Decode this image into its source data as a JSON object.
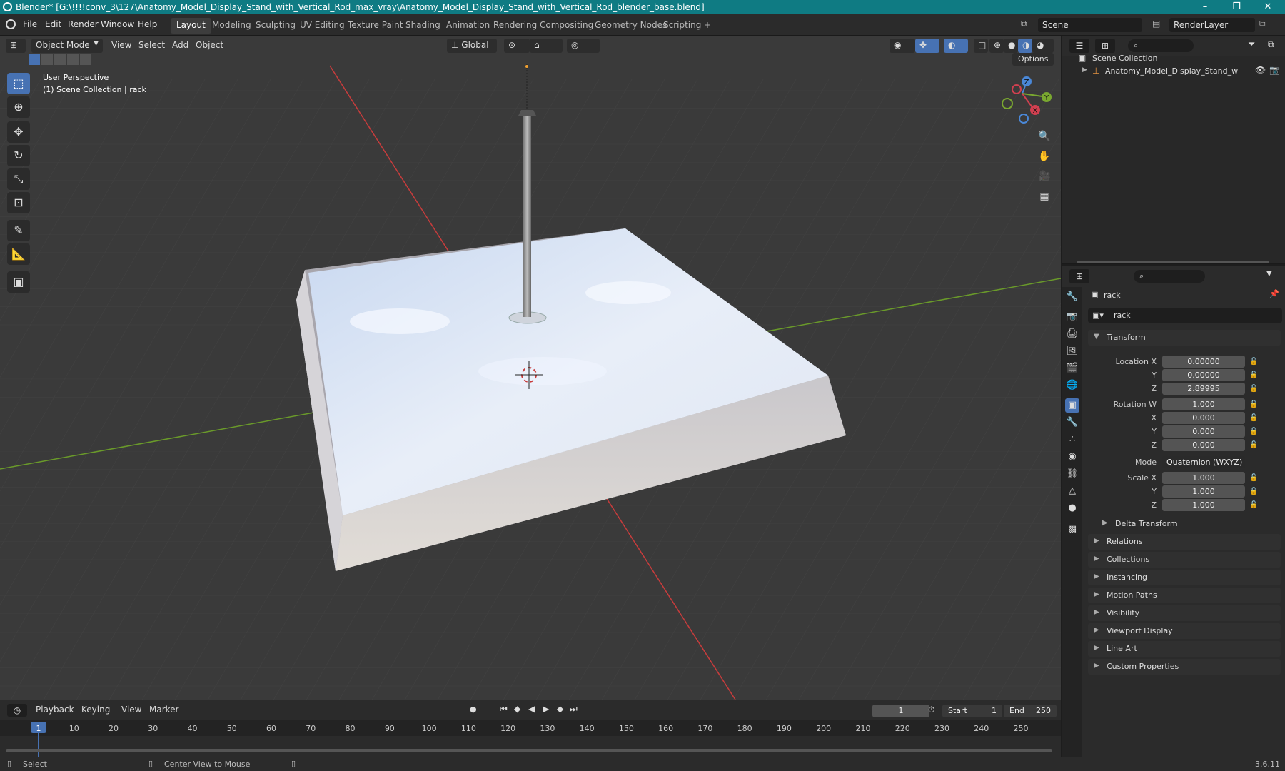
{
  "window": {
    "title": "Blender* [G:\\!!!!conv_3\\127\\Anatomy_Model_Display_Stand_with_Vertical_Rod_max_vray\\Anatomy_Model_Display_Stand_with_Vertical_Rod_blender_base.blend]",
    "minimize": "–",
    "maximize": "❐",
    "close": "✕"
  },
  "menubar": {
    "menus": [
      "File",
      "Edit",
      "Render",
      "Window",
      "Help"
    ],
    "workspaces": [
      "Layout",
      "Modeling",
      "Sculpting",
      "UV Editing",
      "Texture Paint",
      "Shading",
      "Animation",
      "Rendering",
      "Compositing",
      "Geometry Nodes",
      "Scripting"
    ],
    "active_workspace": "Layout",
    "add_workspace": "+",
    "scene": "Scene",
    "view_layer": "RenderLayer"
  },
  "viewport": {
    "mode": "Object Mode",
    "menus": [
      "View",
      "Select",
      "Add",
      "Object"
    ],
    "orientation": "Global",
    "options": "Options",
    "overlay_line1": "User Perspective",
    "overlay_line2": "(1) Scene Collection | rack",
    "gizmo": {
      "x": "X",
      "y": "Y",
      "z": "Z"
    }
  },
  "outliner": {
    "root": "Scene Collection",
    "item": "Anatomy_Model_Display_Stand_with_Ve"
  },
  "properties": {
    "object_name": "rack",
    "data_name": "rack",
    "transform_header": "Transform",
    "location_label": "Location X",
    "location": {
      "x": "0.00000",
      "y": "0.00000",
      "z": "2.89995"
    },
    "rotation_label": "Rotation W",
    "rotation": {
      "w": "1.000",
      "x": "0.000",
      "y": "0.000",
      "z": "0.000"
    },
    "mode_label": "Mode",
    "mode_value": "Quaternion (WXYZ)",
    "scale_label": "Scale X",
    "scale": {
      "x": "1.000",
      "y": "1.000",
      "z": "1.000"
    },
    "axis_y": "Y",
    "axis_x": "X",
    "axis_z": "Z",
    "delta": "Delta Transform",
    "panels": [
      "Relations",
      "Collections",
      "Instancing",
      "Motion Paths",
      "Visibility",
      "Viewport Display",
      "Line Art",
      "Custom Properties"
    ]
  },
  "timeline": {
    "menus": [
      "Playback",
      "Keying",
      "View",
      "Marker"
    ],
    "current_frame": "1",
    "start_label": "Start",
    "start": "1",
    "end_label": "End",
    "end": "250",
    "ticks": [
      "1",
      "10",
      "20",
      "30",
      "40",
      "50",
      "60",
      "70",
      "80",
      "90",
      "100",
      "110",
      "120",
      "130",
      "140",
      "150",
      "160",
      "170",
      "180",
      "190",
      "200",
      "210",
      "220",
      "230",
      "240",
      "250"
    ]
  },
  "statusbar": {
    "select": "Select",
    "center": "Center View to Mouse",
    "version": "3.6.11"
  },
  "colors": {
    "titlebar": "#0f7b83",
    "accent": "#4772b3",
    "x_axis": "#c83c3c",
    "y_axis": "#6a9a2a"
  }
}
